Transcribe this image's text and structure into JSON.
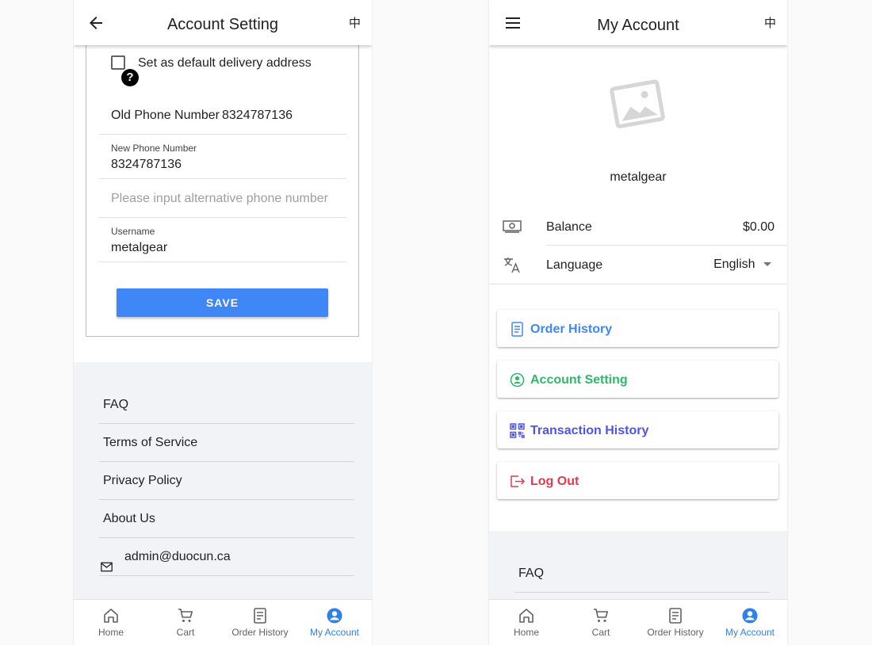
{
  "left": {
    "appbar": {
      "title": "Account Setting",
      "lang": "中"
    },
    "form": {
      "default_address_label": "Set as default delivery address",
      "help_glyph": "?",
      "old_phone_label": "Old Phone Number",
      "old_phone_value": "8324787136",
      "new_phone_label": "New Phone Number",
      "new_phone_value": "8324787136",
      "alt_phone_placeholder": "Please input alternative phone number",
      "username_label": "Username",
      "username_value": "metalgear",
      "save_label": "SAVE"
    },
    "footer": {
      "faq": "FAQ",
      "terms": "Terms of Service",
      "privacy": "Privacy Policy",
      "about": "About Us",
      "email": "admin@duocun.ca"
    }
  },
  "right": {
    "appbar": {
      "title": "My Account",
      "lang": "中"
    },
    "profile": {
      "username": "metalgear"
    },
    "balance": {
      "label": "Balance",
      "value": "$0.00"
    },
    "language": {
      "label": "Language",
      "value": "English"
    },
    "menu": {
      "order_history": "Order History",
      "account_setting": "Account Setting",
      "transaction_history": "Transaction History",
      "log_out": "Log Out"
    },
    "footer": {
      "faq": "FAQ"
    }
  },
  "nav": {
    "home": "Home",
    "cart": "Cart",
    "order_history": "Order History",
    "my_account": "My Account"
  },
  "colors": {
    "primary": "#3f86f7",
    "active_nav": "#2f80ed",
    "green": "#2fb868",
    "indigo": "#4e55e6",
    "red": "#e03b4f",
    "footer_bg": "#f2f3f7"
  }
}
